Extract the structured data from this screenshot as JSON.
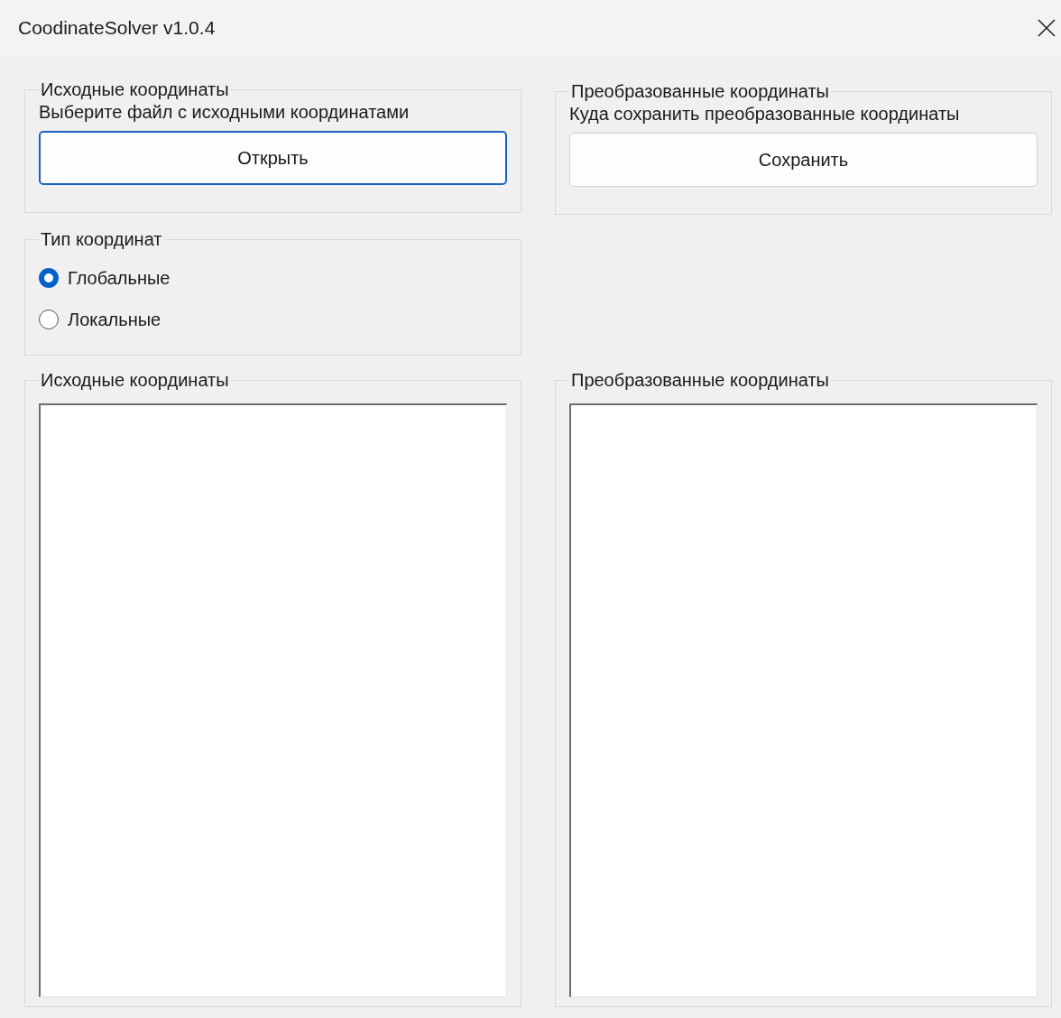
{
  "window": {
    "title": "CoodinateSolver v1.0.4"
  },
  "source_group": {
    "legend": "Исходные координаты",
    "prompt": "Выберите файл с исходными координатами",
    "button": {
      "label": "Открыть",
      "focused": true
    }
  },
  "target_group": {
    "legend": "Преобразованные координаты",
    "prompt": "Куда сохранить преобразованные координаты",
    "button": {
      "label": "Сохранить",
      "focused": false
    }
  },
  "coordinate_type": {
    "legend": "Тип координат",
    "options": [
      {
        "label": "Глобальные",
        "selected": true
      },
      {
        "label": "Локальные",
        "selected": false
      }
    ]
  },
  "text_panels": [
    {
      "legend": "Исходные координаты"
    },
    {
      "legend": "Преобразованные координаты"
    }
  ]
}
